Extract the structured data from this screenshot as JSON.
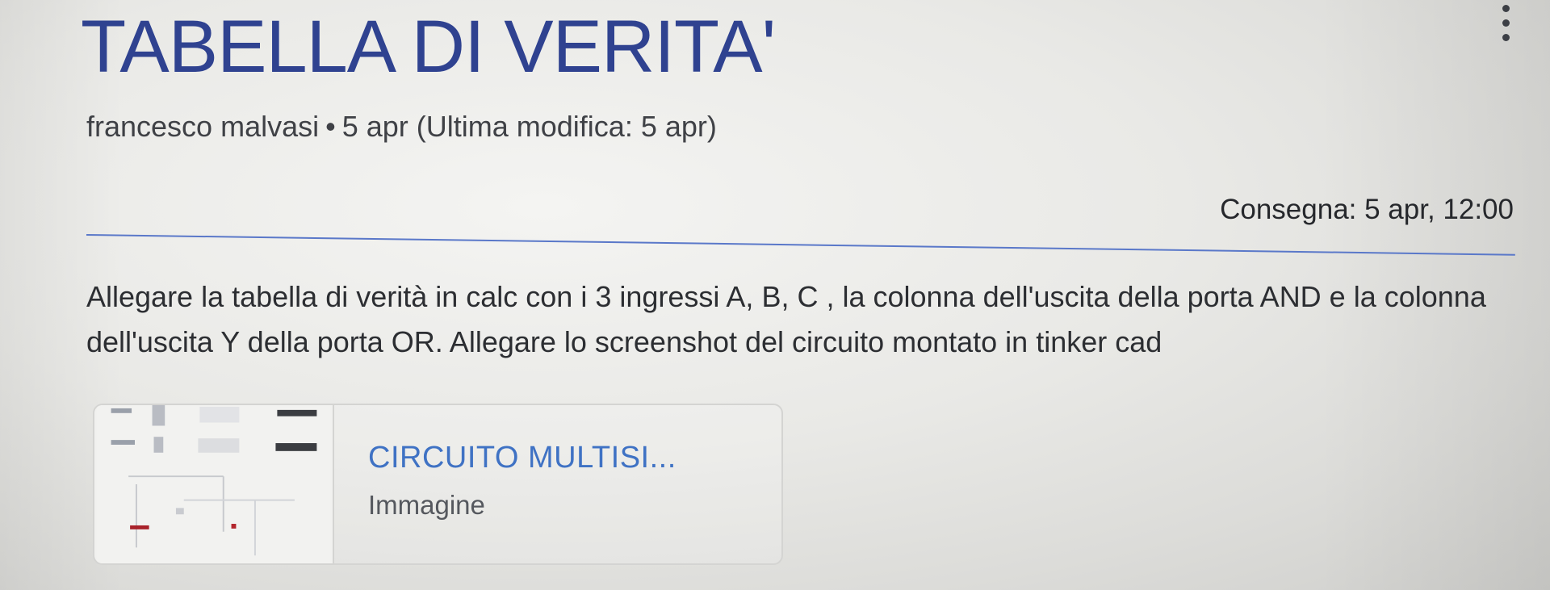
{
  "assignment": {
    "title": "TABELLA DI VERITA'",
    "author": "francesco malvasi",
    "separator": "•",
    "posted": "5 apr (Ultima modifica: 5 apr)",
    "due": "Consegna: 5 apr, 12:00",
    "description": "Allegare la tabella di verità in calc con i 3 ingressi A, B, C  , la colonna dell'uscita della porta AND e la colonna dell'uscita Y della porta OR. Allegare lo screenshot del circuito montato in tinker cad"
  },
  "attachment": {
    "name": "CIRCUITO MULTISI...",
    "type": "Immagine"
  },
  "icons": {
    "more": "more-vert-icon",
    "thumbnail": "circuit-thumbnail"
  },
  "colors": {
    "title": "#2f4290",
    "divider": "#5a78c9",
    "attachment_name": "#3f72c4"
  }
}
